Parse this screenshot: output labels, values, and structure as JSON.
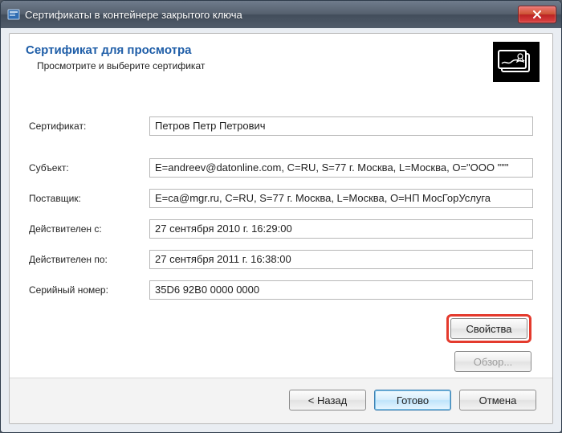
{
  "window": {
    "title": "Сертификаты в контейнере закрытого ключа"
  },
  "header": {
    "title": "Сертификат для просмотра",
    "subtitle": "Просмотрите и выберите сертификат"
  },
  "fields": {
    "cert_label": "Сертификат:",
    "cert_value": "Петров Петр Петрович",
    "subject_label": "Субъект:",
    "subject_value": "E=andreev@datonline.com, C=RU, S=77 г. Москва, L=Москва, O=\"ООО \"\"\"",
    "issuer_label": "Поставщик:",
    "issuer_value": "E=ca@mgr.ru, C=RU, S=77 г. Москва, L=Москва, O=НП МосГорУслуга",
    "valid_from_label": "Действителен с:",
    "valid_from_value": "27 сентября 2010 г. 16:29:00",
    "valid_to_label": "Действителен по:",
    "valid_to_value": "27 сентября 2011 г. 16:38:00",
    "serial_label": "Серийный номер:",
    "serial_value": "35D6 92B0 0000 0000"
  },
  "buttons": {
    "properties": "Свойства",
    "browse": "Обзор...",
    "back": "< Назад",
    "finish": "Готово",
    "cancel": "Отмена"
  }
}
